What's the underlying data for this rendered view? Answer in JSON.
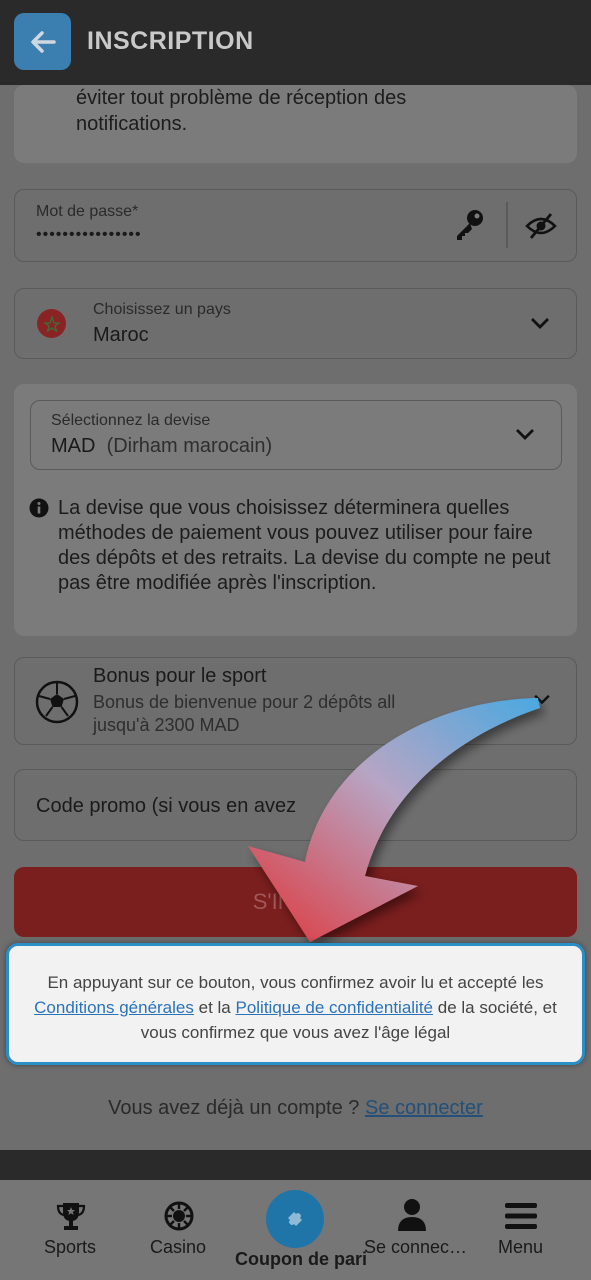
{
  "header": {
    "title": "INSCRIPTION",
    "back_icon": "arrow-left-icon"
  },
  "note": {
    "line1": "éviter tout problème de réception des",
    "line2": "notifications."
  },
  "password": {
    "label": "Mot de passe*",
    "value": "••••••••••••••••"
  },
  "country": {
    "label": "Choisissez un pays",
    "value": "Maroc"
  },
  "currency": {
    "label": "Sélectionnez la devise",
    "value": "MAD",
    "value_detail": "(Dirham marocain)",
    "info": "La devise que vous choisissez déterminera quelles méthodes de paiement vous pouvez utiliser pour faire des dépôts et des retraits. La devise du compte ne peut pas être modifiée après l'inscription."
  },
  "bonus": {
    "title": "Bonus pour le sport",
    "line1": "Bonus de bienvenue pour 2 dépôts all",
    "line2": "jusqu'à 2300 MAD"
  },
  "promo": {
    "placeholder": "Code promo (si vous en avez"
  },
  "register_button": {
    "label": "S'INS"
  },
  "tooltip": {
    "prefix": "En appuyant sur ce bouton, vous confirmez avoir lu et accepté les",
    "terms_link": "Conditions générales",
    "middle": "et la",
    "privacy_link": "Politique de confidentialité",
    "suffix": "de la société, et vous confirmez que vous avez l'âge légal"
  },
  "login": {
    "prompt": "Vous avez déjà un compte ?",
    "link": "Se connecter"
  },
  "nav": [
    {
      "label": "Sports",
      "icon": "trophy-icon"
    },
    {
      "label": "Casino",
      "icon": "casino-chip-icon"
    },
    {
      "label": "Coupon de pari",
      "icon": "ticket-icon"
    },
    {
      "label": "Se connec…",
      "icon": "user-icon"
    },
    {
      "label": "Menu",
      "icon": "hamburger-icon"
    }
  ],
  "colors": {
    "accent": "#2a8fc7",
    "register": "#7a1e1e",
    "overlay": "#6e6e6e"
  }
}
